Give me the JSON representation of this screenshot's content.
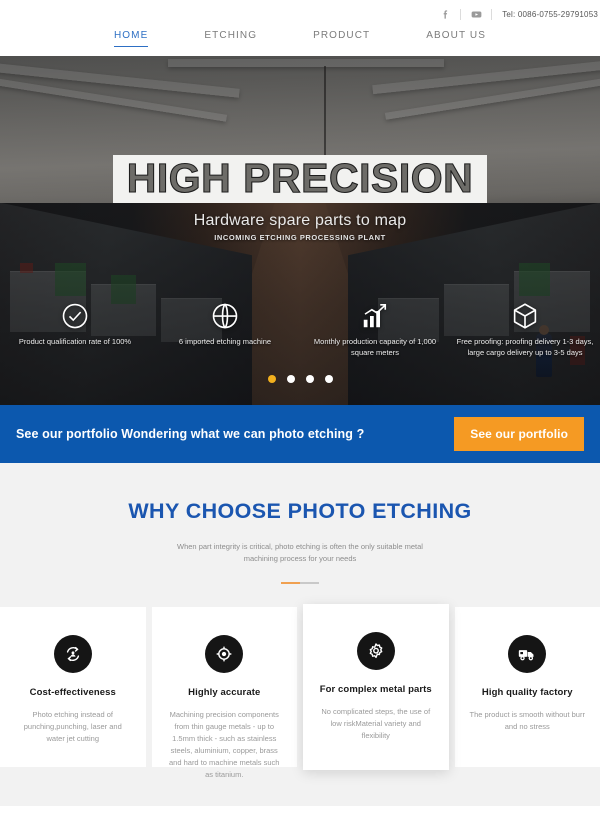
{
  "topbar": {
    "social": [
      {
        "name": "facebook-icon",
        "label": "f"
      },
      {
        "name": "youtube-icon",
        "label": "YouTube"
      }
    ],
    "tel": "Tel: 0086-0755-29791053"
  },
  "nav": {
    "items": [
      {
        "label": "HOME",
        "active": true,
        "name": "nav-item-home"
      },
      {
        "label": "ETCHING",
        "active": false,
        "name": "nav-item-etching"
      },
      {
        "label": "PRODUCT",
        "active": false,
        "name": "nav-item-product"
      },
      {
        "label": "ABOUT US",
        "active": false,
        "name": "nav-item-about-us"
      }
    ]
  },
  "hero": {
    "title": "HIGH PRECISION",
    "subtitle": "Hardware spare parts to map",
    "tagline": "INCOMING ETCHING PROCESSING PLANT",
    "features": [
      {
        "icon": "check-circle-icon",
        "text": "Product qualification rate of 100%"
      },
      {
        "icon": "globe-icon",
        "text": "6 imported etching machine"
      },
      {
        "icon": "bar-chart-icon",
        "text": "Monthly production capacity of 1,000 square meters"
      },
      {
        "icon": "box-icon",
        "text": "Free proofing: proofing delivery 1-3 days, large cargo delivery up to 3-5 days"
      }
    ],
    "dots": {
      "count": 4,
      "active_index": 0,
      "active_color": "#f2b01e",
      "color": "#ffffff"
    }
  },
  "cta": {
    "text": "See our portfolio Wondering what we can photo etching ?",
    "button_label": "See our portfolio",
    "background": "#0c58ae",
    "button_color": "#f59a23"
  },
  "why": {
    "title": "WHY CHOOSE PHOTO ETCHING",
    "title_color": "#1b56b0",
    "subtitle": "When part integrity is critical, photo etching is often the only suitable metal machining process for your needs",
    "cards": [
      {
        "icon": "recycle-person-icon",
        "title": "Cost-effectiveness",
        "body": "Photo etching instead of punching,punching, laser and water jet cutting",
        "raised": false
      },
      {
        "icon": "target-icon",
        "title": "Highly accurate",
        "body": "Machining precision components from thin gauge metals - up to 1.5mm thick - such as stainless steels, aluminium, copper, brass and hard to machine metals such as titanium.",
        "raised": false
      },
      {
        "icon": "gear-icon",
        "title": "For complex metal parts",
        "body": "No complicated steps, the use of low riskMaterial variety and flexibility",
        "raised": true
      },
      {
        "icon": "truck-icon",
        "title": "High quality factory",
        "body": "The product is smooth without burr and no stress",
        "raised": false
      }
    ]
  }
}
